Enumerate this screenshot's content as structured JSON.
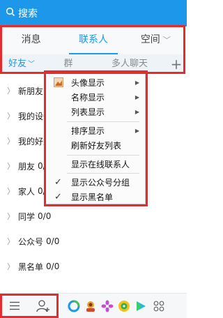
{
  "search": {
    "placeholder": "搜索"
  },
  "main_tabs": [
    {
      "label": "消息"
    },
    {
      "label": "联系人"
    },
    {
      "label": "空间"
    }
  ],
  "sub_tabs": {
    "friends": "好友",
    "group": "群",
    "multi_chat": "多人聊天"
  },
  "contact_groups": [
    {
      "name": "新朋友",
      "count": ""
    },
    {
      "name": "我的设备",
      "count": ""
    },
    {
      "name": "我的好友",
      "count": ""
    },
    {
      "name": "朋友",
      "count": "0/0"
    },
    {
      "name": "家人",
      "count": "0/0"
    },
    {
      "name": "同学",
      "count": "0/0"
    },
    {
      "name": "公众号",
      "count": "0/0"
    },
    {
      "name": "黑名单",
      "count": "0/0"
    }
  ],
  "context_menu": {
    "items": [
      {
        "label": "头像显示",
        "submenu": true,
        "checked": false,
        "icon": "avatar-display-icon"
      },
      {
        "label": "名称显示",
        "submenu": true,
        "checked": false
      },
      {
        "label": "列表显示",
        "submenu": true,
        "checked": false
      },
      {
        "label": "排序显示",
        "submenu": true,
        "checked": false
      },
      {
        "label": "刷新好友列表",
        "submenu": false,
        "checked": false
      },
      {
        "label": "显示在线联系人",
        "submenu": false,
        "checked": false
      },
      {
        "label": "显示公众号分组",
        "submenu": false,
        "checked": true
      },
      {
        "label": "显示黑名单",
        "submenu": false,
        "checked": true
      }
    ]
  },
  "colors": {
    "accent": "#1c97ea",
    "highlight": "#e52b2b"
  },
  "bottom_bar": {
    "icons": [
      "menu-icon",
      "add-contact-icon",
      "qq-browser-icon",
      "game-icon",
      "flower-icon",
      "music-icon",
      "video-icon",
      "app-grid-icon"
    ]
  }
}
